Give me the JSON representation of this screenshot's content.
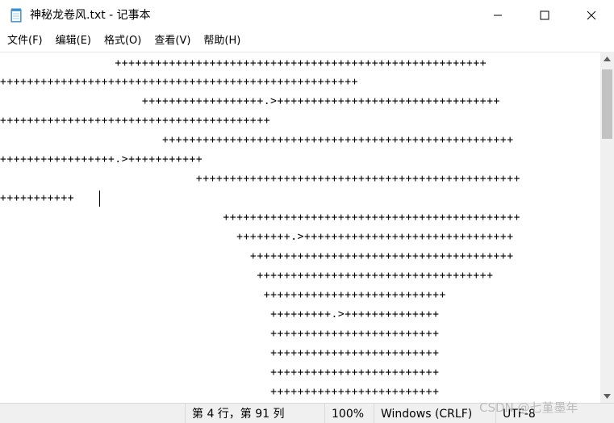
{
  "window": {
    "title": "神秘龙卷风.txt - 记事本",
    "minimize_icon": "minimize-icon",
    "maximize_icon": "maximize-icon",
    "close_icon": "close-icon",
    "app_icon": "notepad-icon"
  },
  "menu": {
    "items": [
      {
        "label": "文件(F)"
      },
      {
        "label": "编辑(E)"
      },
      {
        "label": "格式(O)"
      },
      {
        "label": "查看(V)"
      },
      {
        "label": "帮助(H)"
      }
    ]
  },
  "editor": {
    "lines": [
      "                 +++++++++++++++++++++++++++++++++++++++++++++++++++++++",
      "+++++++++++++++++++++++++++++++++++++++++++++++++++++",
      "                     ++++++++++++++++++.>+++++++++++++++++++++++++++++++++",
      "++++++++++++++++++++++++++++++++++++++++",
      "                        ++++++++++++++++++++++++++++++++++++++++++++++++++++",
      "+++++++++++++++++.>+++++++++++",
      "                             ++++++++++++++++++++++++++++++++++++++++++++++++",
      "+++++++++++",
      "                                 ++++++++++++++++++++++++++++++++++++++++++++",
      "                                   ++++++++.>+++++++++++++++++++++++++++++++",
      "                                     +++++++++++++++++++++++++++++++++++++++",
      "                                      +++++++++++++++++++++++++++++++++++",
      "                                       +++++++++++++++++++++++++++",
      "                                        +++++++++.>++++++++++++++",
      "                                        +++++++++++++++++++++++++",
      "                                        +++++++++++++++++++++++++",
      "                                        +++++++++++++++++++++++++",
      "                                        +++++++++++++++++++++++++"
    ]
  },
  "status": {
    "position": "第 4 行，第 91 列",
    "zoom": "100%",
    "line_ending": "Windows (CRLF)",
    "encoding": "UTF-8"
  },
  "watermark": "CSDN @七堇墨年"
}
